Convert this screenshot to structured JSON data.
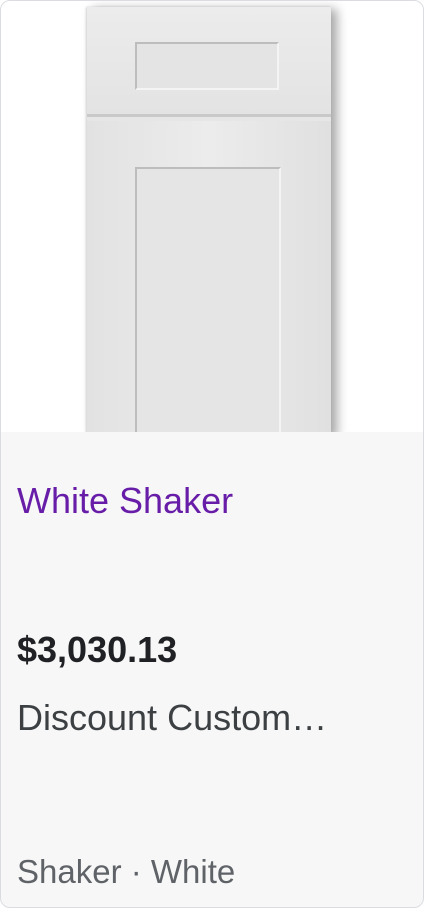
{
  "product": {
    "image_alt": "White Shaker cabinet door",
    "title": "White Shaker",
    "price": "$3,030.13",
    "seller": "Discount Custom…",
    "tags": "Shaker · White"
  },
  "colors": {
    "title": "#681da8",
    "price": "#202124",
    "seller": "#3c4043",
    "tags": "#5f6368",
    "card_bg": "#f7f7f7"
  }
}
